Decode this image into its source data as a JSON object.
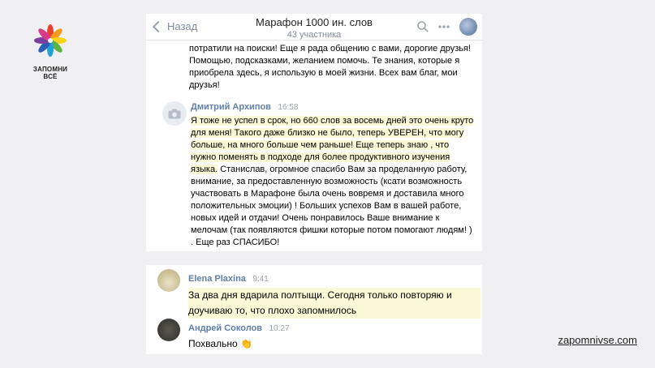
{
  "brand": {
    "name": "ЗАПОМНИ ВСЁ",
    "site": "zapomnivse.com"
  },
  "chat": {
    "back_label": "Назад",
    "title": "Марафон 1000 ин. слов",
    "participants": "43 участника"
  },
  "messages": {
    "previous_tail": "потратили на поиски! Еще я рада общению с вами, дорогие друзья! Помощью, подсказками, желанием помочь. Те знания, которые я приобрела здесь, я использую в моей жизни. Всех вам благ, мои друзья!",
    "dmitry": {
      "author": "Дмитрий Архипов",
      "time": "16:58",
      "highlighted": "Я тоже не успел в срок, но 660 слов за восемь дней это очень круто для меня! Такого даже близко не было, теперь УВЕРЕН, что могу больше, на много больше чем раньше! Еще теперь знаю , что нужно поменять в подходе для более продуктивного изучения языка.",
      "rest": "Станислав, огромное спасибо Вам за проделанную работу, внимание, за предоставленную возможность (ксати возможность участвовать в Марафоне была очень вовремя и доставила много положительных эмоции) ! Больших успехов Вам в вашей работе, новых идей и отдачи! Очень понравилось Ваше внимание к мелочам (так появляются фишки которые потом помогают людям! ) . Еще раз СПАСИБО!"
    },
    "elena": {
      "author": "Elena Plaxina",
      "time": "9:41",
      "text": "За два дня вдарила полтыщи. Сегодня только повторяю и доучиваю то, что плохо запомнилось"
    },
    "andrey": {
      "author": "Андрей Соколов",
      "time": "10:27",
      "text": "Похвально",
      "emoji": "👏"
    }
  },
  "colors": {
    "highlight": "#fbf8d6",
    "author": "#5e7fa8",
    "background": "#f0f0f2"
  }
}
